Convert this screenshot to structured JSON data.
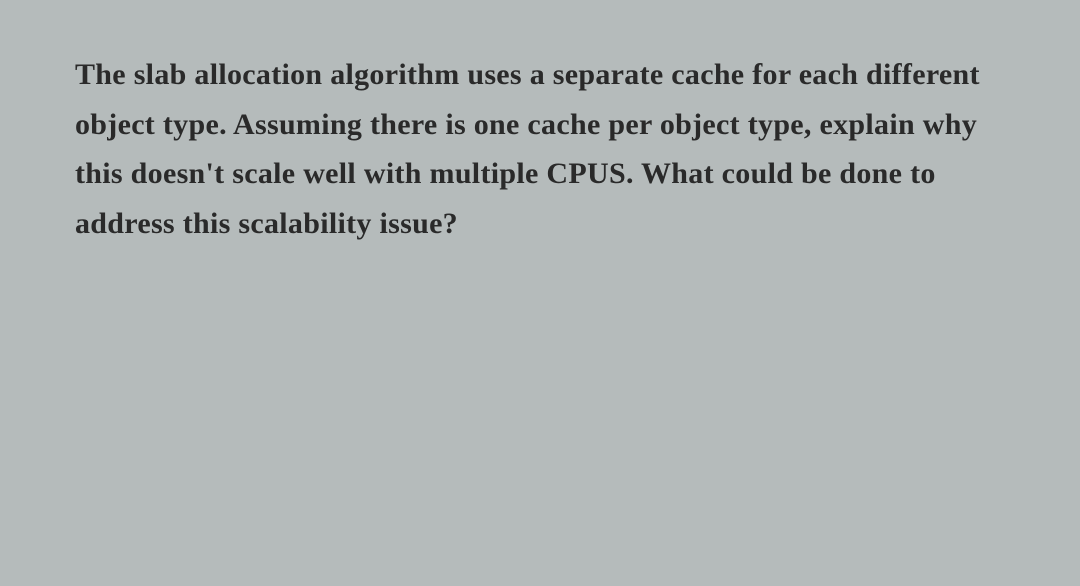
{
  "question": {
    "text": "The slab allocation algorithm uses a separate cache for each different object type. Assuming there is one cache per object type, explain why this doesn't scale well with multiple CPUS. What could be done to address this scalability issue?"
  }
}
